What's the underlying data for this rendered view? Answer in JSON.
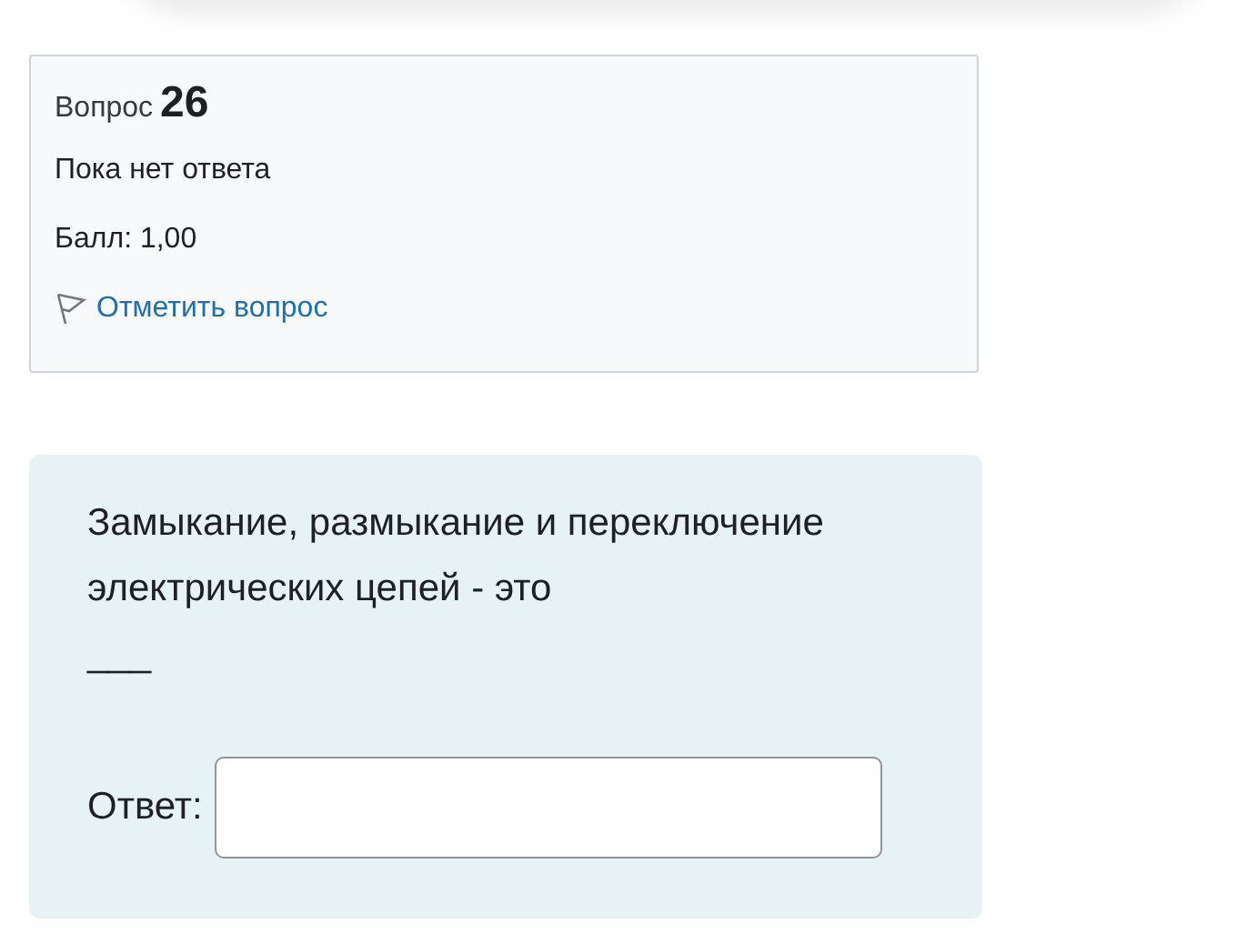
{
  "info": {
    "label": "Вопрос",
    "number": "26",
    "status": "Пока нет ответа",
    "grade": "Балл: 1,00",
    "flag_link": "Отметить вопрос"
  },
  "question": {
    "prompt": "Замыкание, размыкание и переключение электрических цепей - это",
    "blank": "___",
    "answer_label": "Ответ:"
  }
}
